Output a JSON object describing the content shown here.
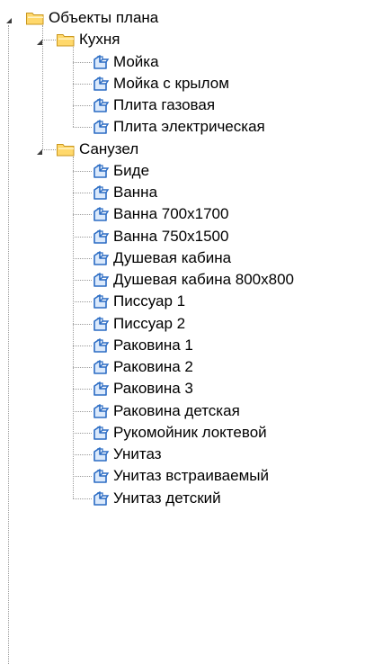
{
  "tree": {
    "label": "Объекты плана",
    "icon": "folder-icon",
    "expanded": true,
    "children": [
      {
        "label": "Кухня",
        "icon": "folder-icon",
        "expanded": true,
        "children": [
          {
            "label": "Мойка",
            "icon": "block-icon"
          },
          {
            "label": "Мойка с крылом",
            "icon": "block-icon"
          },
          {
            "label": "Плита газовая",
            "icon": "block-icon"
          },
          {
            "label": "Плита электрическая",
            "icon": "block-icon"
          }
        ]
      },
      {
        "label": "Санузел",
        "icon": "folder-icon",
        "expanded": true,
        "children": [
          {
            "label": "Биде",
            "icon": "block-icon"
          },
          {
            "label": "Ванна",
            "icon": "block-icon"
          },
          {
            "label": "Ванна 700x1700",
            "icon": "block-icon"
          },
          {
            "label": "Ванна 750x1500",
            "icon": "block-icon"
          },
          {
            "label": "Душевая кабина",
            "icon": "block-icon"
          },
          {
            "label": "Душевая кабина 800x800",
            "icon": "block-icon"
          },
          {
            "label": "Писсуар 1",
            "icon": "block-icon"
          },
          {
            "label": "Писсуар 2",
            "icon": "block-icon"
          },
          {
            "label": "Раковина 1",
            "icon": "block-icon"
          },
          {
            "label": "Раковина 2",
            "icon": "block-icon"
          },
          {
            "label": "Раковина 3",
            "icon": "block-icon"
          },
          {
            "label": "Раковина детская",
            "icon": "block-icon"
          },
          {
            "label": "Рукомойник локтевой",
            "icon": "block-icon"
          },
          {
            "label": "Унитаз",
            "icon": "block-icon"
          },
          {
            "label": "Унитаз встраиваемый",
            "icon": "block-icon"
          },
          {
            "label": "Унитаз детский",
            "icon": "block-icon"
          }
        ]
      }
    ]
  },
  "colors": {
    "folder_fill": "#ffd86b",
    "folder_stroke": "#c8961e",
    "block_stroke": "#2b6cc4",
    "block_fill": "#dbe9fb",
    "connector": "#9a9a9a",
    "expander": "#3c3c3c"
  }
}
